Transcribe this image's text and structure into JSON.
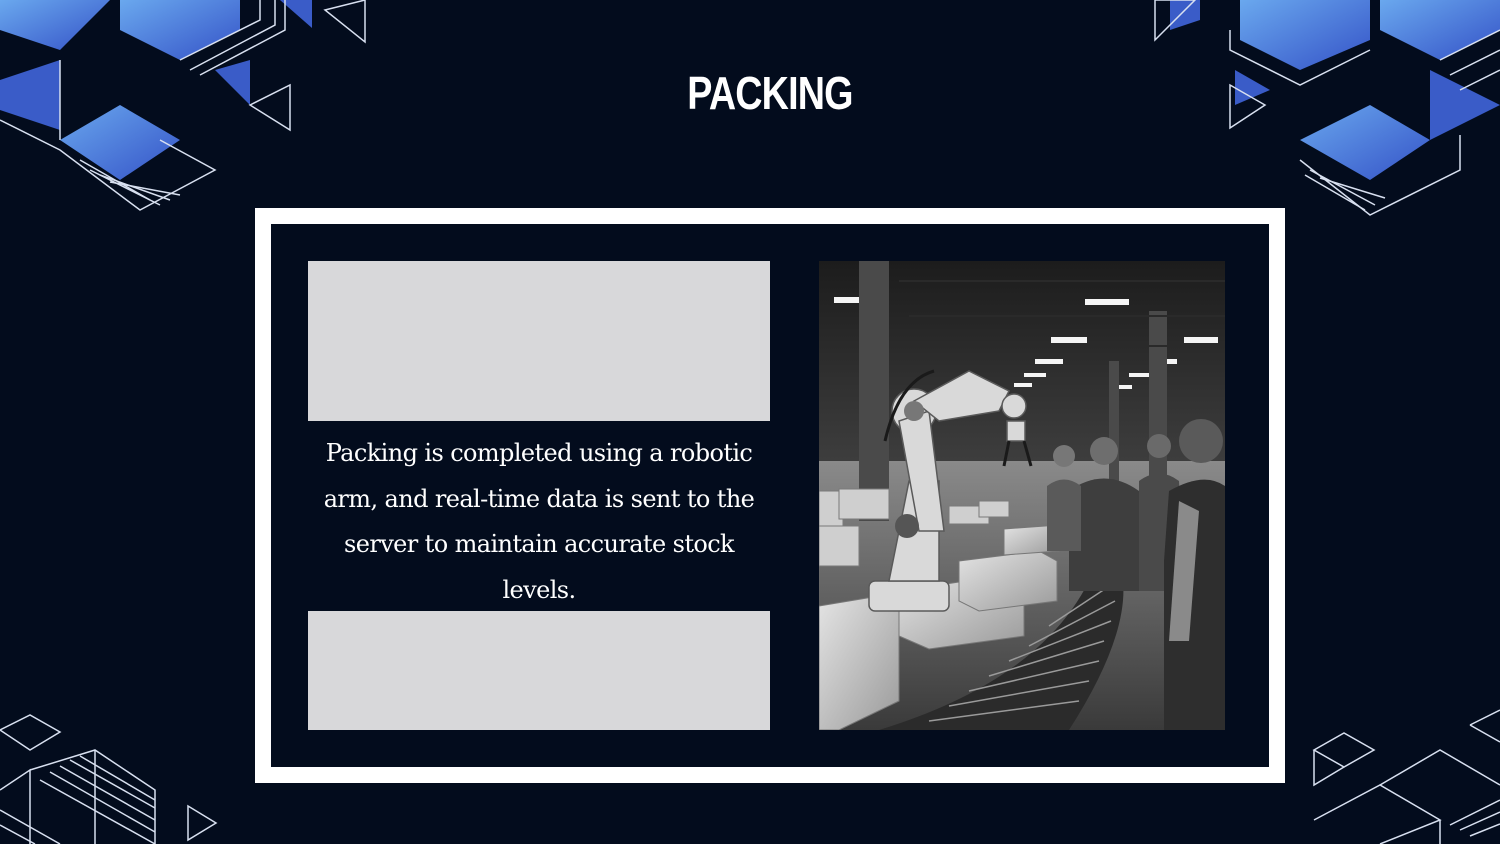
{
  "slide": {
    "title": "PACKING",
    "body_text": "Packing is completed using a robotic arm, and real-time data is sent to the server to maintain accurate stock levels.",
    "image_description_icon": "robotic-arm-warehouse-photo"
  },
  "colors": {
    "background": "#030c1d",
    "frame": "#ffffff",
    "panel": "#d8d8da",
    "accent_blue": "#4a7be0",
    "accent_blue_dark": "#3a5cc8"
  }
}
